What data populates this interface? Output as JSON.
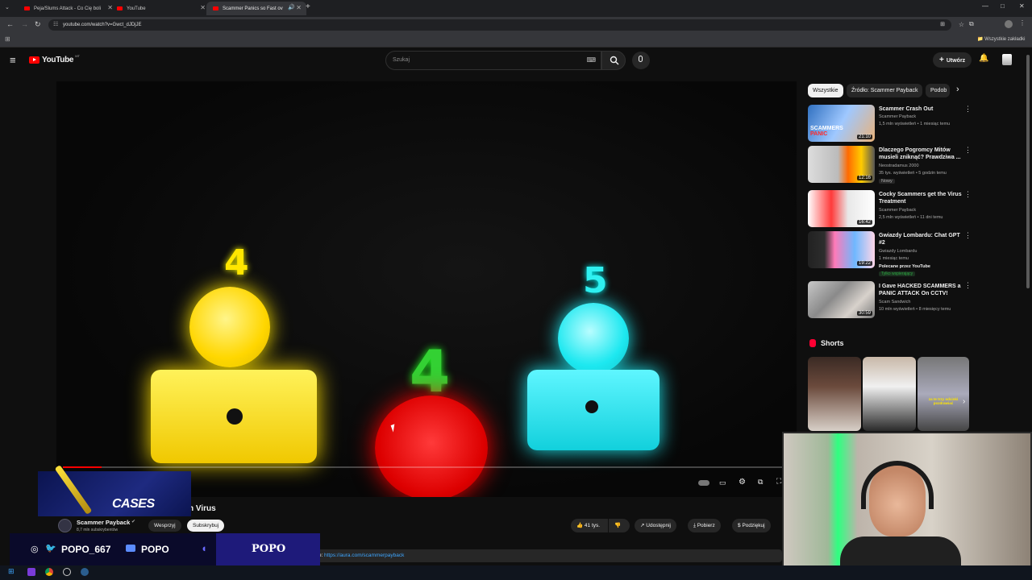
{
  "tabs": [
    {
      "title": "Peja/Slums Attack - Co Cię boli"
    },
    {
      "title": "YouTube"
    },
    {
      "title": "Scammer Panics so Fast ov"
    }
  ],
  "url": "youtube.com/watch?v=Gwct_dJDjJE",
  "bookmarks_label": "Wszystkie zakładki",
  "header": {
    "logo": "YouTube",
    "region": "MT",
    "search_placeholder": "Szukaj",
    "create_label": "Utwórz"
  },
  "video": {
    "numbers": [
      "4",
      "4",
      "5"
    ],
    "title_visible": "n Virus"
  },
  "channel": {
    "name": "Scammer Payback",
    "subs": "8,7 mln subskrybentów",
    "join_label": "Wesprzyj",
    "subscribe_label": "Subskrybuj"
  },
  "actions": {
    "likes": "41 tys.",
    "share": "Udostępnij",
    "download": "Pobierz",
    "thanks": "Podziękuj"
  },
  "description_link": "https://aura.com/scammerpayback",
  "description_prefix": "e:",
  "filters": [
    "Wszystkie",
    "Źródło: Scammer Payback",
    "Podob"
  ],
  "recommended": [
    {
      "title": "Scammer Crash Out",
      "channel": "Scammer Payback",
      "meta": "1,5 mln wyświetleń • 1 miesiąc temu",
      "duration": "21:10",
      "badge": ""
    },
    {
      "title": "Dlaczego Pogromcy Mitów musieli zniknąć? Prawdziwa ...",
      "channel": "Neostradamus 2000",
      "meta": "35 tys. wyświetleń • 5 godzin temu",
      "duration": "12:16",
      "badge": "Nowy"
    },
    {
      "title": "Cocky Scammers get the Virus Treatment",
      "channel": "Scammer Payback",
      "meta": "2,5 mln wyświetleń • 11 dni temu",
      "duration": "16:42",
      "badge": ""
    },
    {
      "title": "Gwiazdy Lombardu: Chat GPT #2",
      "channel": "Gwiazdy Lombardu",
      "meta": "1 miesiąc temu",
      "duration": "19:22",
      "badge": "Polecane przez YouTube",
      "badge2": "Tylko wspierający"
    },
    {
      "title": "I Gave HACKED SCAMMERS a PANIC ATTACK On CCTV!",
      "channel": "Scam Sandwich",
      "meta": "10 mln wyświetleń • 8 miesięcy temu",
      "duration": "30:59",
      "badge": ""
    }
  ],
  "shorts_label": "Shorts",
  "shorts_overlay_text": "za te trzy odcinki pozdrawiać",
  "overlay": {
    "cases_label": "CASES",
    "social_handle": "POPO_667",
    "yt_handle": "POPO",
    "brand": "POPO"
  },
  "colors": {
    "yt_red": "#ff0000",
    "yellow": "#ffe600",
    "red": "#e01010",
    "cyan": "#1ee8f0",
    "overlay_bg": "#1a1a5e"
  }
}
